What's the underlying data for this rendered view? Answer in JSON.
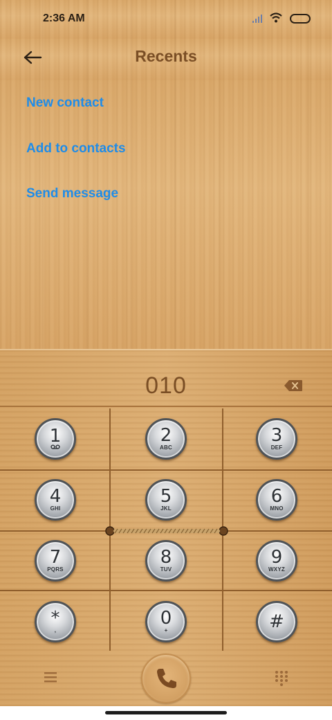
{
  "status_bar": {
    "time": "2:36 AM"
  },
  "header": {
    "title": "Recents"
  },
  "actions": [
    {
      "label": "New contact"
    },
    {
      "label": "Add to contacts"
    },
    {
      "label": "Send message"
    }
  ],
  "dialer": {
    "number": "010",
    "keys": [
      {
        "digit": "1",
        "letters": ""
      },
      {
        "digit": "2",
        "letters": "ABC"
      },
      {
        "digit": "3",
        "letters": "DEF"
      },
      {
        "digit": "4",
        "letters": "GHI"
      },
      {
        "digit": "5",
        "letters": "JKL"
      },
      {
        "digit": "6",
        "letters": "MNO"
      },
      {
        "digit": "7",
        "letters": "PQRS"
      },
      {
        "digit": "8",
        "letters": "TUV"
      },
      {
        "digit": "9",
        "letters": "WXYZ"
      },
      {
        "digit": "*",
        "letters": ","
      },
      {
        "digit": "0",
        "letters": "+"
      },
      {
        "digit": "#",
        "letters": ""
      }
    ]
  },
  "icons": {
    "back": "back-arrow-icon",
    "backspace": "backspace-icon",
    "menu": "menu-icon",
    "call": "phone-icon",
    "keypad": "dialpad-icon",
    "voicemail": "voicemail-icon"
  },
  "colors": {
    "link": "#1f8ce8",
    "title": "#7a4e25",
    "wood": "#dcae72"
  }
}
